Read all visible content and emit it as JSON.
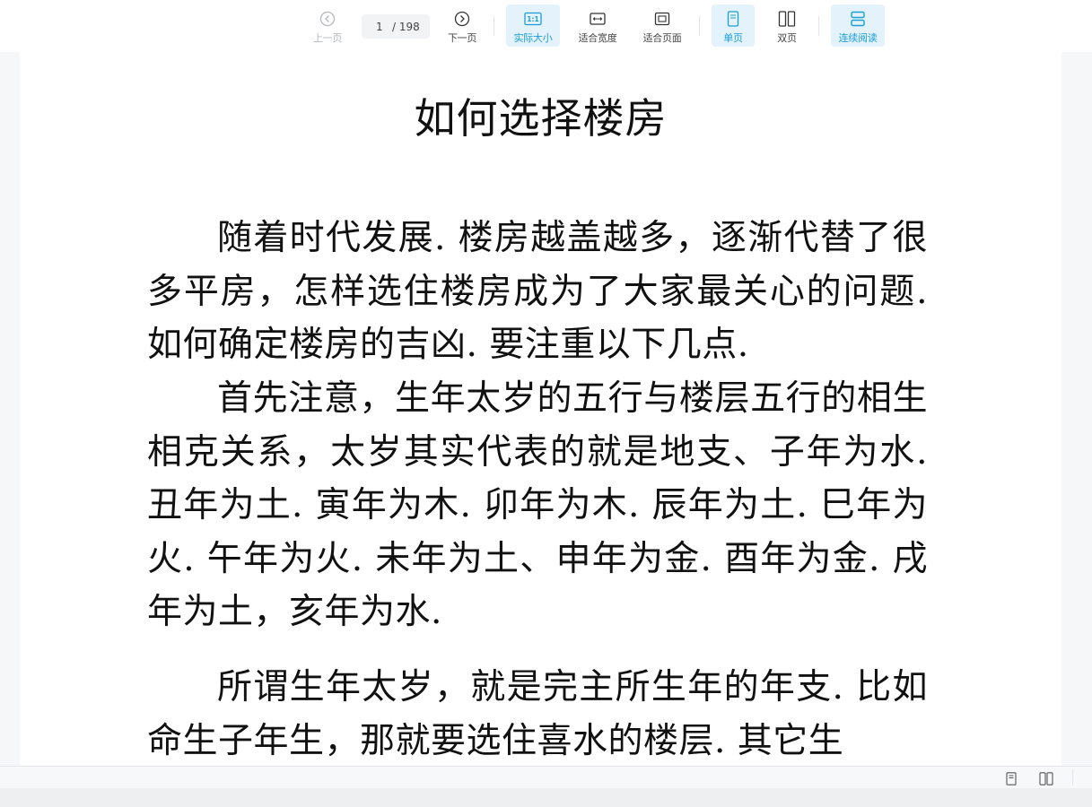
{
  "toolbar": {
    "prev_page": "上一页",
    "page_current": "1",
    "page_total": "/ 198",
    "next_page": "下一页",
    "actual_size": "实际大小",
    "fit_width": "适合宽度",
    "fit_page": "适合页面",
    "single_page": "单页",
    "double_page": "双页",
    "continuous": "连续阅读",
    "actual_size_icon_text": "1:1"
  },
  "document": {
    "title": "如何选择楼房",
    "paragraphs": [
      "随着时代发展. 楼房越盖越多，逐渐代替了很多平房，怎样选住楼房成为了大家最关心的问题. 如何确定楼房的吉凶. 要注重以下几点.",
      "首先注意，生年太岁的五行与楼层五行的相生相克关系，太岁其实代表的就是地支、子年为水. 丑年为土. 寅年为木. 卯年为木. 辰年为土. 巳年为火. 午年为火. 未年为土、申年为金. 酉年为金. 戌年为土，亥年为水.",
      "所谓生年太岁，就是完主所生年的年支. 比如命生子年生，那就要选住喜水的楼层. 其它生"
    ]
  },
  "colors": {
    "accent": "#1a9ed8",
    "active_bg": "#e3f2fb"
  }
}
